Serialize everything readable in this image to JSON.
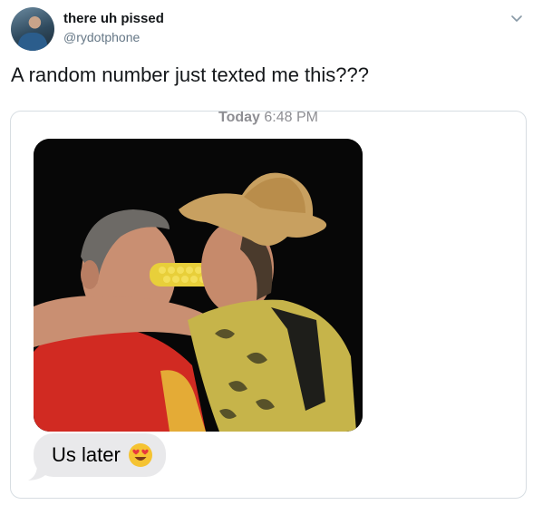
{
  "tweet": {
    "display_name": "there uh pissed",
    "handle": "@rydotphone",
    "text": "A random number just texted me this???"
  },
  "message": {
    "timestamp_day": "Today",
    "timestamp_time": "6:48 PM",
    "bubble_text": "Us later",
    "bubble_emoji": "heart-eyes-emoji"
  },
  "colors": {
    "bubble_bg": "#e9e9eb",
    "timestamp": "#8e8e93",
    "handle": "#657786"
  }
}
